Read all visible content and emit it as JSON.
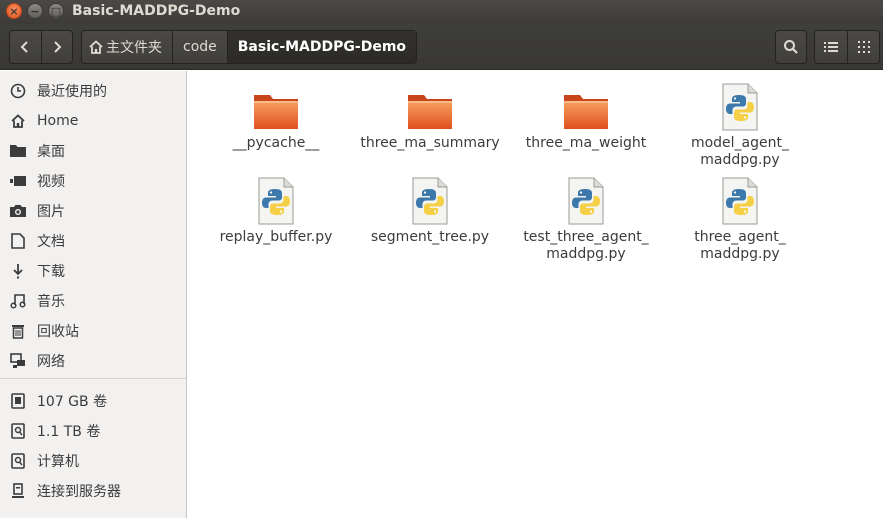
{
  "window": {
    "title": "Basic-MADDPG-Demo",
    "close_glyph": "×",
    "minimize_glyph": "−",
    "maximize_glyph": "□"
  },
  "toolbar": {
    "back_icon": "chevron-left-icon",
    "forward_icon": "chevron-right-icon",
    "breadcrumbs": [
      {
        "label": "主文件夹",
        "icon": "home-icon"
      },
      {
        "label": "code"
      },
      {
        "label": "Basic-MADDPG-Demo"
      }
    ],
    "search_icon": "search-icon",
    "list_view_icon": "list-view-icon",
    "grid_view_icon": "grid-view-icon"
  },
  "sidebar": {
    "items": [
      {
        "label": "最近使用的",
        "icon": "clock-icon"
      },
      {
        "label": "Home",
        "icon": "home-icon"
      },
      {
        "label": "桌面",
        "icon": "folder-icon"
      },
      {
        "label": "视频",
        "icon": "video-icon"
      },
      {
        "label": "图片",
        "icon": "camera-icon"
      },
      {
        "label": "文档",
        "icon": "document-icon"
      },
      {
        "label": "下载",
        "icon": "download-icon"
      },
      {
        "label": "音乐",
        "icon": "music-icon"
      },
      {
        "label": "回收站",
        "icon": "trash-icon"
      },
      {
        "label": "网络",
        "icon": "network-icon"
      }
    ],
    "devices": [
      {
        "label": "107 GB 卷",
        "icon": "drive-icon"
      },
      {
        "label": "1.1 TB 卷",
        "icon": "drive-icon"
      },
      {
        "label": "计算机",
        "icon": "drive-icon"
      },
      {
        "label": "连接到服务器",
        "icon": "server-icon"
      }
    ]
  },
  "files": [
    {
      "name": "__pycache__",
      "type": "folder"
    },
    {
      "name": "three_ma_summary",
      "type": "folder"
    },
    {
      "name": "three_ma_weight",
      "type": "folder"
    },
    {
      "name": "model_agent_\nmaddpg.py",
      "type": "python"
    },
    {
      "name": "replay_buffer.py",
      "type": "python"
    },
    {
      "name": "segment_tree.py",
      "type": "python"
    },
    {
      "name": "test_three_agent_\nmaddpg.py",
      "type": "python"
    },
    {
      "name": "three_agent_\nmaddpg.py",
      "type": "python"
    }
  ],
  "colors": {
    "folder": "#e8622c",
    "folder_light": "#f7a05f",
    "python_blue": "#3d78aa",
    "python_yellow": "#f5cf45"
  }
}
